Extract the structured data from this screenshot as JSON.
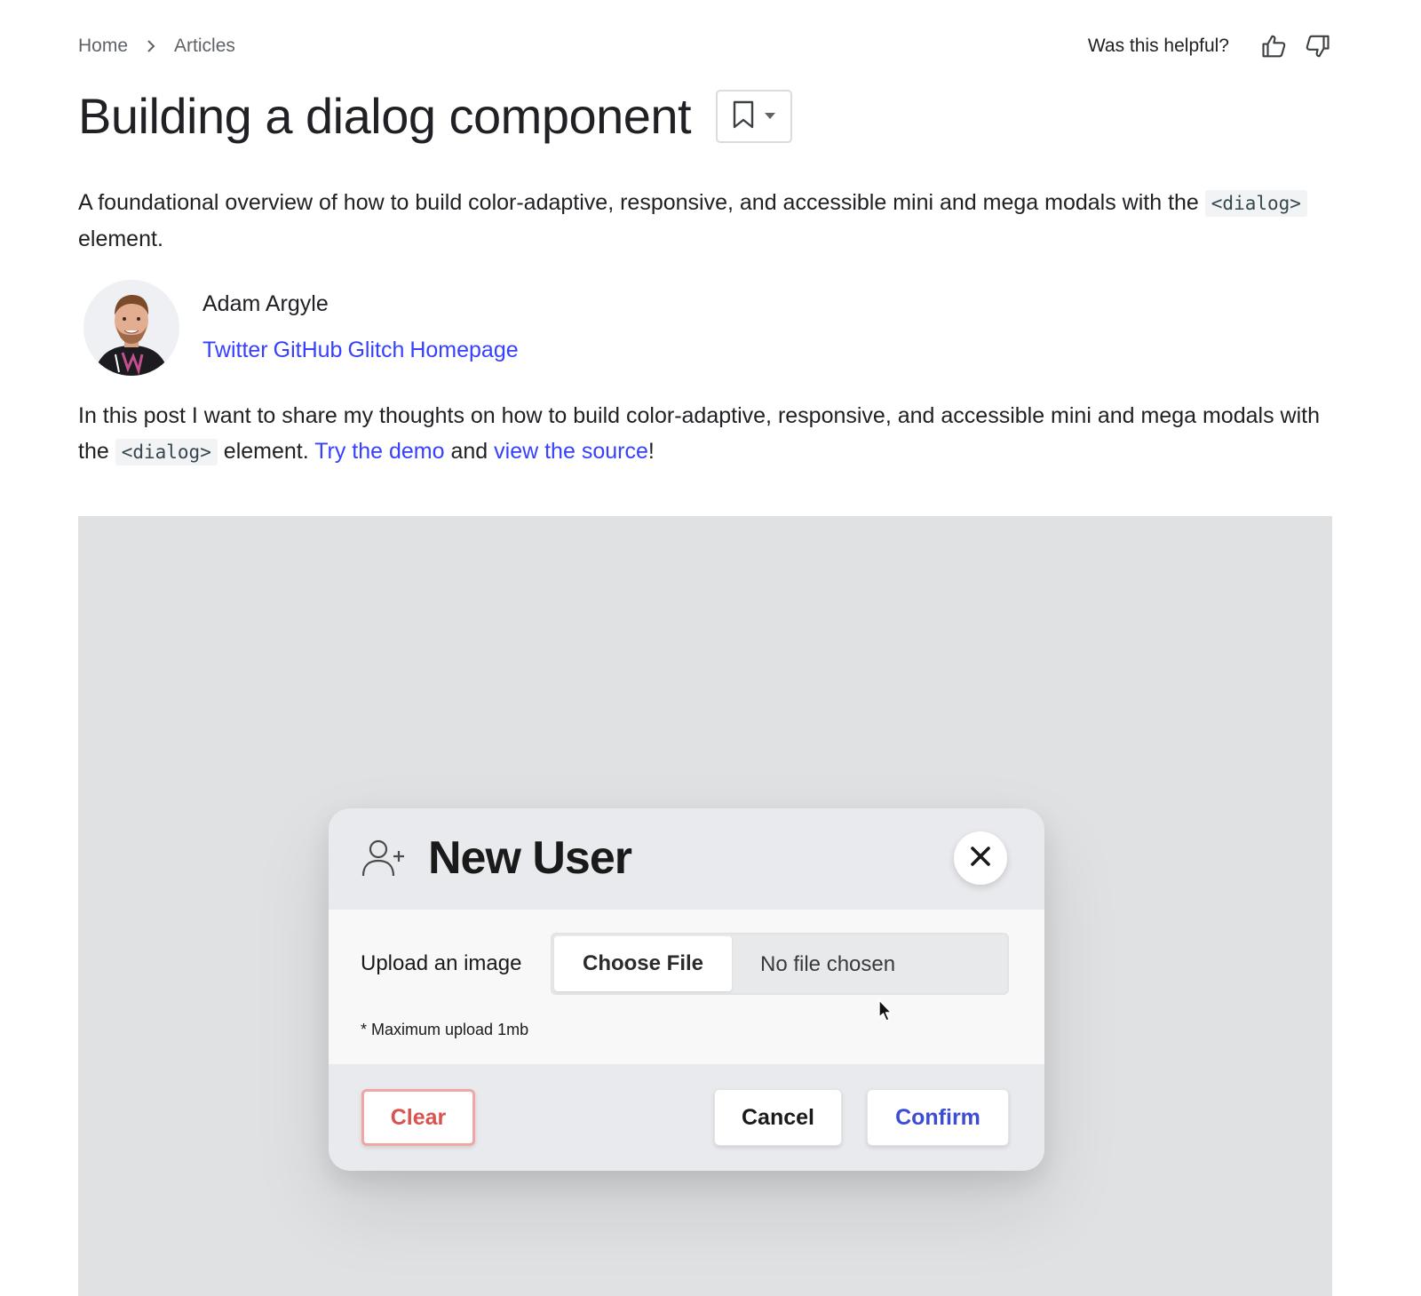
{
  "breadcrumb": {
    "home": "Home",
    "articles": "Articles"
  },
  "feedback": {
    "question": "Was this helpful?"
  },
  "article": {
    "title": "Building a dialog component",
    "lede_before": "A foundational overview of how to build color-adaptive, responsive, and accessible mini and mega modals with the ",
    "lede_code": "<dialog>",
    "lede_after": " element.",
    "author": {
      "name": "Adam Argyle",
      "links": [
        "Twitter",
        "GitHub",
        "Glitch",
        "Homepage"
      ]
    },
    "intro_before": "In this post I want to share my thoughts on how to build color-adaptive, responsive, and accessible mini and mega modals with the ",
    "intro_code": "<dialog>",
    "intro_mid": " element. ",
    "intro_link1": "Try the demo",
    "intro_and": " and ",
    "intro_link2": "view the source",
    "intro_end": "!"
  },
  "dialog": {
    "title": "New User",
    "upload_label": "Upload an image",
    "choose_file": "Choose File",
    "file_status": "No file chosen",
    "hint": "* Maximum upload 1mb",
    "clear": "Clear",
    "cancel": "Cancel",
    "confirm": "Confirm"
  },
  "colors": {
    "link": "#3740ff",
    "clear": "#d9534f",
    "confirm": "#3b4cd6"
  }
}
